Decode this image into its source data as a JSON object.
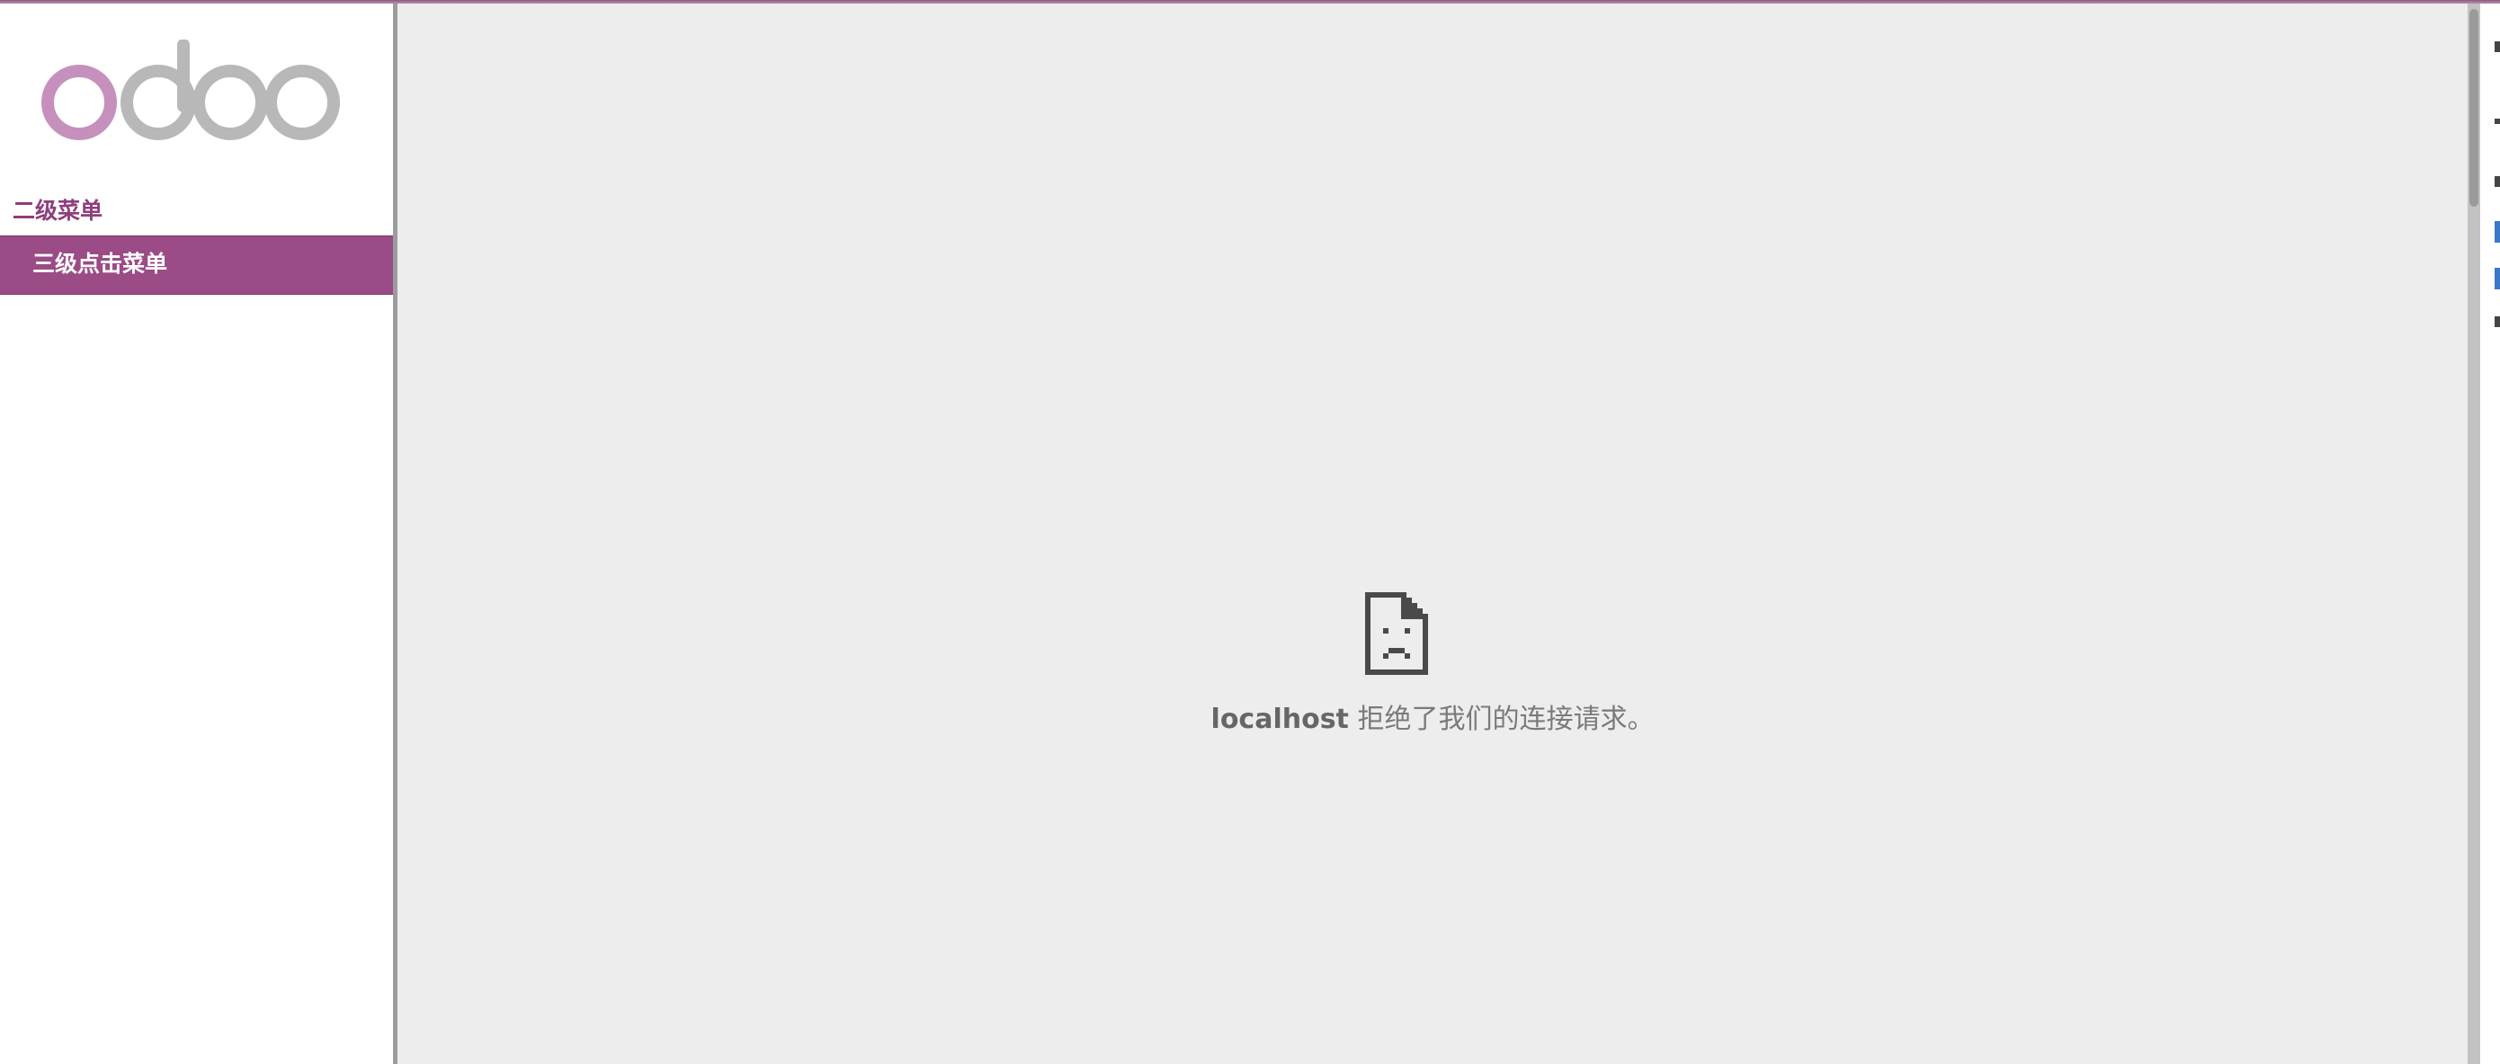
{
  "app": {
    "logo_text": "odoo",
    "accent_color": "#9b4b86",
    "section_color": "#8f3d7c"
  },
  "sidebar": {
    "section_title": "二级菜单",
    "items": [
      {
        "label": "三级点击菜单",
        "active": true
      }
    ]
  },
  "main": {
    "error_icon": "sad-document-icon",
    "error_host": "localhost",
    "error_message": " 拒绝了我们的连接请求。"
  }
}
